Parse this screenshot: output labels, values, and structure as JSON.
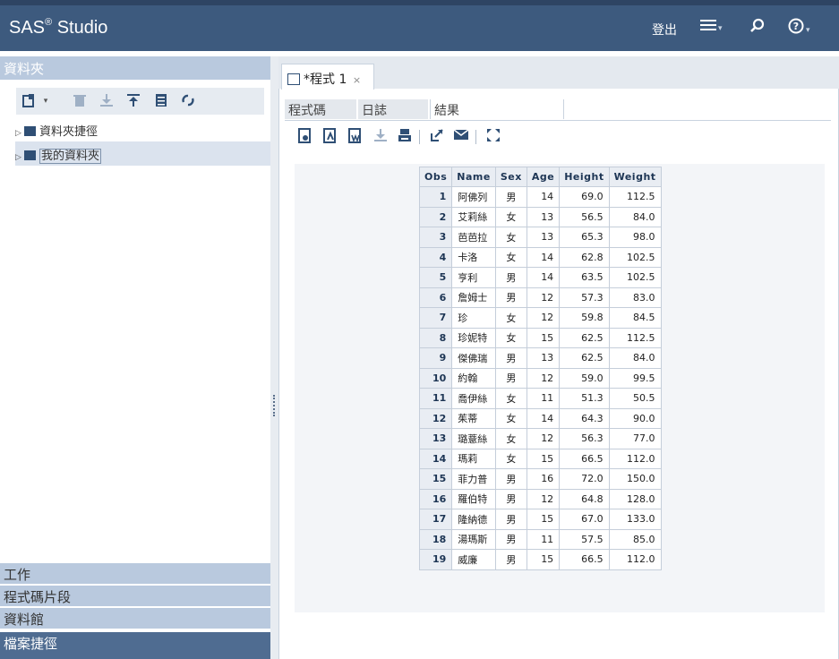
{
  "header": {
    "app_name": "SAS",
    "app_name_suffix": "Studio",
    "reg_mark": "®",
    "signout_label": "登出",
    "menu_icon": "hamburger-menu-icon",
    "search_icon": "search-icon",
    "help_icon": "help-icon",
    "bg_color": "#3d5a7e"
  },
  "leftpane": {
    "folders_title": "資料夾",
    "tree": [
      {
        "label": "資料夾捷徑"
      },
      {
        "label": "我的資料夾",
        "selected": true
      }
    ],
    "sections": {
      "tasks": "工作",
      "snippets": "程式碼片段",
      "libraries": "資料館",
      "file_shortcuts": "檔案捷徑"
    }
  },
  "program_tab": {
    "label": "*程式 1",
    "close": "×"
  },
  "subtabs": {
    "code": "程式碼",
    "log": "日誌",
    "results": "結果",
    "active": "results"
  },
  "table": {
    "headers": [
      "Obs",
      "Name",
      "Sex",
      "Age",
      "Height",
      "Weight"
    ],
    "rows": [
      [
        "1",
        "阿佛列",
        "男",
        "14",
        "69.0",
        "112.5"
      ],
      [
        "2",
        "艾莉絲",
        "女",
        "13",
        "56.5",
        "84.0"
      ],
      [
        "3",
        "芭芭拉",
        "女",
        "13",
        "65.3",
        "98.0"
      ],
      [
        "4",
        "卡洛",
        "女",
        "14",
        "62.8",
        "102.5"
      ],
      [
        "5",
        "亨利",
        "男",
        "14",
        "63.5",
        "102.5"
      ],
      [
        "6",
        "詹姆士",
        "男",
        "12",
        "57.3",
        "83.0"
      ],
      [
        "7",
        "珍",
        "女",
        "12",
        "59.8",
        "84.5"
      ],
      [
        "8",
        "珍妮特",
        "女",
        "15",
        "62.5",
        "112.5"
      ],
      [
        "9",
        "傑佛瑞",
        "男",
        "13",
        "62.5",
        "84.0"
      ],
      [
        "10",
        "約翰",
        "男",
        "12",
        "59.0",
        "99.5"
      ],
      [
        "11",
        "喬伊絲",
        "女",
        "11",
        "51.3",
        "50.5"
      ],
      [
        "12",
        "茱蒂",
        "女",
        "14",
        "64.3",
        "90.0"
      ],
      [
        "13",
        "璐薏絲",
        "女",
        "12",
        "56.3",
        "77.0"
      ],
      [
        "14",
        "瑪莉",
        "女",
        "15",
        "66.5",
        "112.0"
      ],
      [
        "15",
        "菲力普",
        "男",
        "16",
        "72.0",
        "150.0"
      ],
      [
        "16",
        "羅伯特",
        "男",
        "12",
        "64.8",
        "128.0"
      ],
      [
        "17",
        "隆納德",
        "男",
        "15",
        "67.0",
        "133.0"
      ],
      [
        "18",
        "湯瑪斯",
        "男",
        "11",
        "57.5",
        "85.0"
      ],
      [
        "19",
        "威廉",
        "男",
        "15",
        "66.5",
        "112.0"
      ]
    ]
  }
}
